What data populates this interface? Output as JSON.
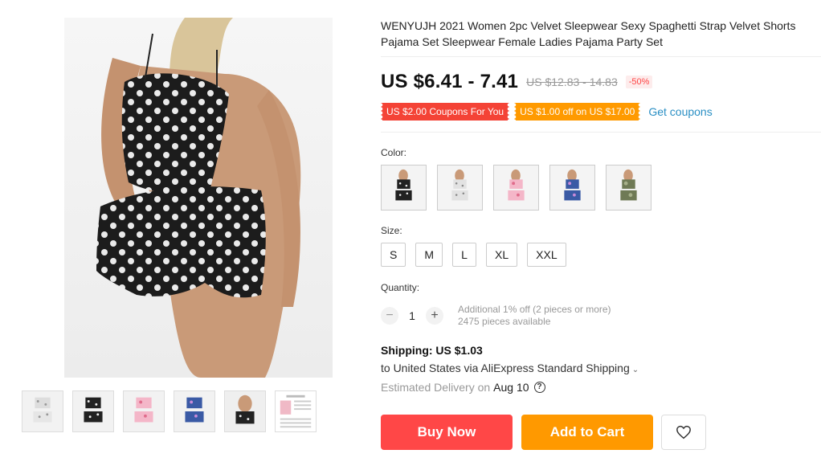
{
  "product": {
    "title": "WENYUJH 2021 Women 2pc Velvet Sleepwear Sexy Spaghetti Strap Velvet Shorts Pajama Set Sleepwear Female Ladies Pajama Party Set",
    "price": "US $6.41 - 7.41",
    "old_price": "US $12.83 - 14.83",
    "discount": "-50%"
  },
  "coupons": {
    "coupon1": "US $2.00 Coupons For You",
    "coupon2": "US $1.00 off on US $17.00",
    "get_label": "Get coupons"
  },
  "color": {
    "label": "Color:",
    "options": [
      "black-dots",
      "white-dots",
      "pink-print",
      "blue-print",
      "camo-print"
    ]
  },
  "size": {
    "label": "Size:",
    "options": [
      "S",
      "M",
      "L",
      "XL",
      "XXL"
    ]
  },
  "quantity": {
    "label": "Quantity:",
    "minus": "−",
    "value": "1",
    "plus": "+",
    "info_line1": "Additional 1% off (2 pieces or more)",
    "info_line2": "2475 pieces available"
  },
  "shipping": {
    "title": "Shipping: US $1.03",
    "route": "to United States via AliExpress Standard Shipping",
    "delivery_label": "Estimated Delivery on",
    "delivery_date": "Aug 10"
  },
  "actions": {
    "buy_now": "Buy Now",
    "add_to_cart": "Add to Cart"
  },
  "icons": {
    "chevron": "chevron-down-icon",
    "help": "question-circle-icon",
    "wishlist": "heart-icon"
  },
  "colors": {
    "buy": "#ff4747",
    "cart": "#ff9900",
    "coupon_red": "#f44336",
    "coupon_orange": "#ff9a00",
    "link": "#2a8fc4"
  }
}
